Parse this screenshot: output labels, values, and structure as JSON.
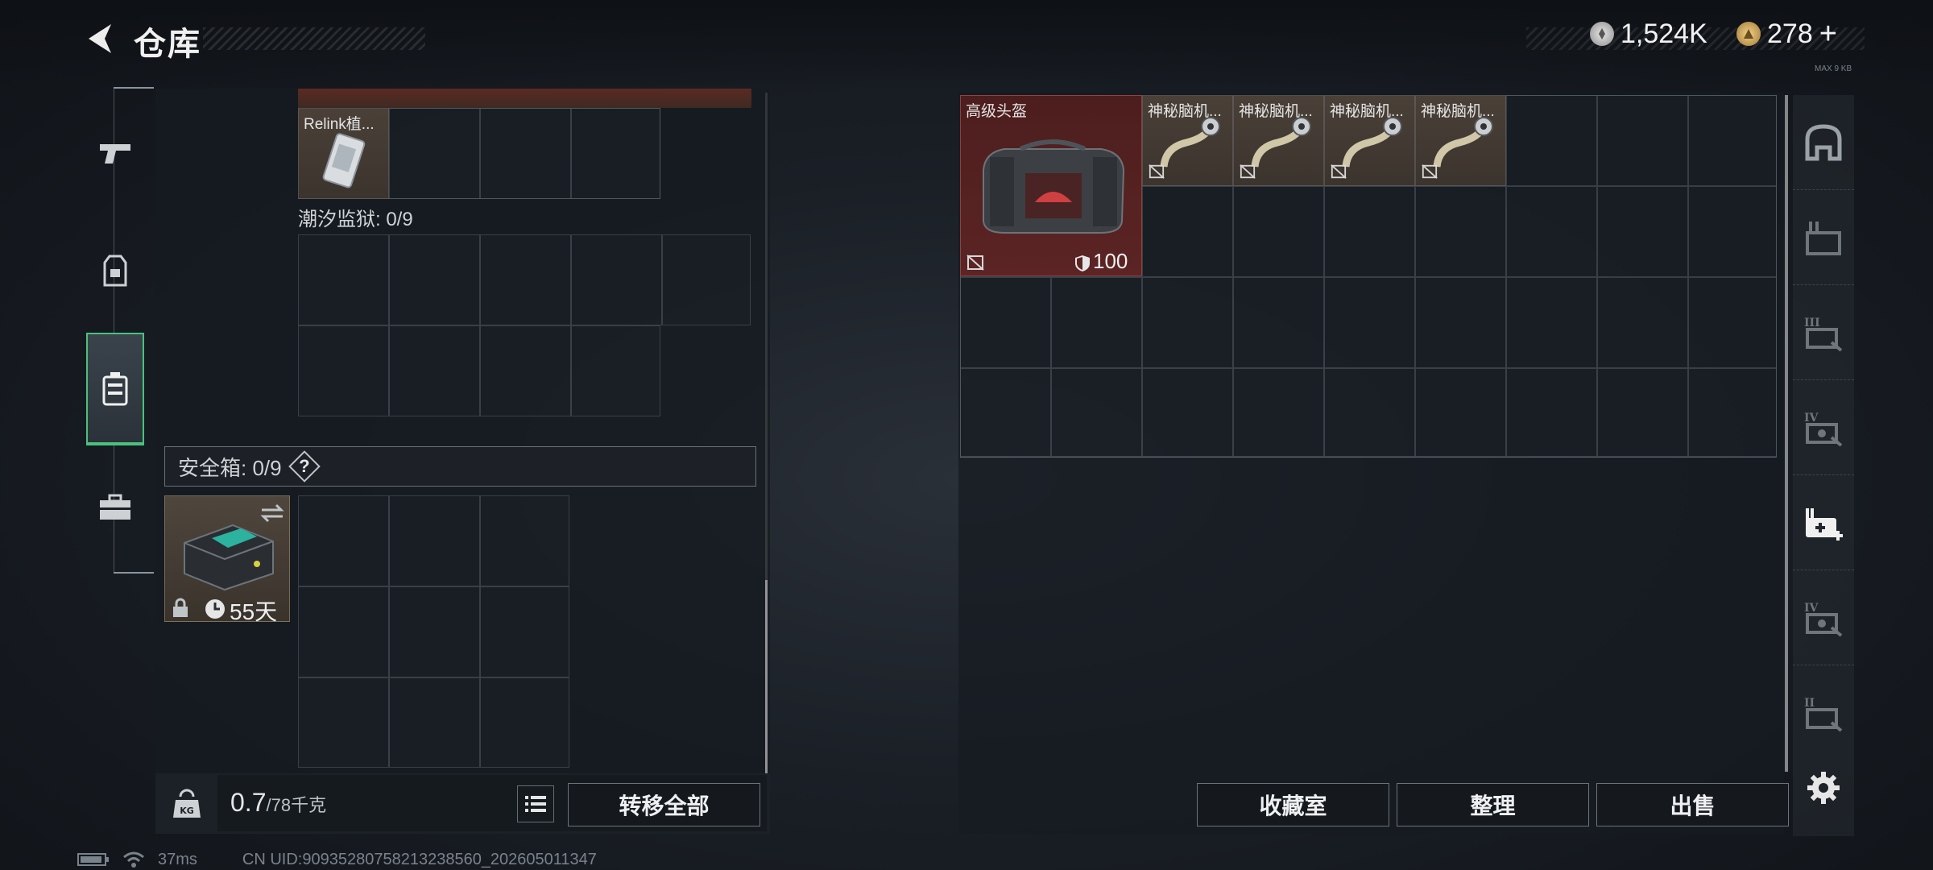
{
  "header": {
    "title": "仓库",
    "currency_silver": "1,524K",
    "currency_gold": "278",
    "gold_plus": "+",
    "small_tag": "MAX 9 KB"
  },
  "left_nav": {
    "items": [
      {
        "name": "weapons",
        "icon": "pistol-icon"
      },
      {
        "name": "gear",
        "icon": "backpack-armor-icon"
      },
      {
        "name": "containers",
        "icon": "case-icon",
        "active": true
      },
      {
        "name": "tools",
        "icon": "toolbox-icon"
      }
    ]
  },
  "containers": {
    "top_item_label": "Relink植...",
    "tide_prison_label": "潮汐监狱: 0/9",
    "safe_box_label": "安全箱: 0/9",
    "safe_box_help": "?",
    "safe_box_timer": "55天"
  },
  "bottom_left": {
    "weight_current": "0.7",
    "weight_max": "/78千克",
    "transfer_all": "转移全部"
  },
  "stash": {
    "items": [
      {
        "name": "高级头盔",
        "durability": "100",
        "color": "#5c2424"
      },
      {
        "name": "神秘脑机..."
      },
      {
        "name": "神秘脑机..."
      },
      {
        "name": "神秘脑机..."
      },
      {
        "name": "神秘脑机..."
      }
    ]
  },
  "bottom_right": {
    "collection": "收藏室",
    "organize": "整理",
    "sell": "出售"
  },
  "right_nav": {
    "items": [
      "armor-icon",
      "ammo-crate-icon",
      "tier-III-keycard-icon",
      "tier-IV-keycard-icon",
      "medkit-plus-icon",
      "tier-IV-keycard-icon",
      "tier-II-keycard-icon"
    ]
  },
  "status": {
    "ping": "37ms",
    "uid": "CN UID:90935280758213238560_202605011347"
  },
  "colors": {
    "accent_green": "#49c27c",
    "item_red": "#5c2424",
    "item_brown": "#4a4038"
  }
}
